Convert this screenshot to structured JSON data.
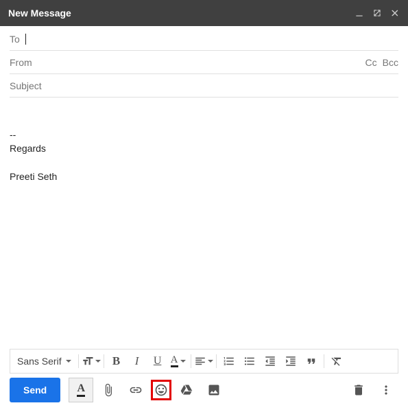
{
  "header": {
    "title": "New Message"
  },
  "fields": {
    "to_label": "To",
    "from_label": "From",
    "cc_label": "Cc",
    "bcc_label": "Bcc",
    "subject_placeholder": "Subject"
  },
  "body": {
    "sig_sep": "--",
    "sig_line1": "Regards",
    "sig_line2": "Preeti Seth"
  },
  "format": {
    "font": "Sans Serif"
  },
  "actions": {
    "send": "Send",
    "text_color_a": "A"
  }
}
